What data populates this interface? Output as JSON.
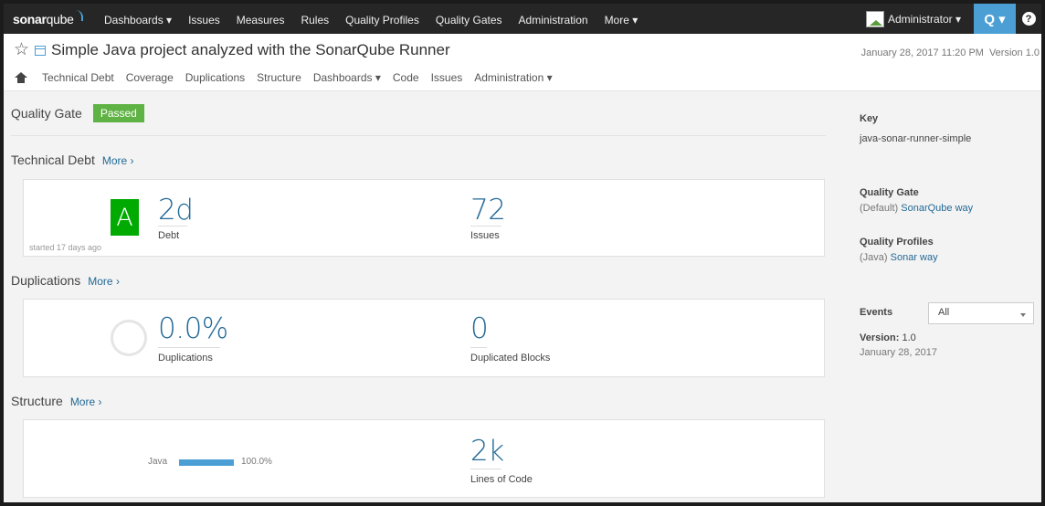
{
  "app": {
    "logo_bold": "sonar",
    "logo_rest": "qube"
  },
  "nav": {
    "items": [
      {
        "label": "Dashboards ▾"
      },
      {
        "label": "Issues"
      },
      {
        "label": "Measures"
      },
      {
        "label": "Rules"
      },
      {
        "label": "Quality Profiles"
      },
      {
        "label": "Quality Gates"
      },
      {
        "label": "Administration"
      },
      {
        "label": "More ▾"
      }
    ],
    "user_label": "Administrator ▾",
    "search_label": "Q ▾",
    "help_label": "?"
  },
  "project": {
    "name": "Simple Java project analyzed with the SonarQube Runner",
    "date": "January 28, 2017 11:20 PM",
    "version": "Version 1.0",
    "subnav": [
      {
        "label": "Technical Debt"
      },
      {
        "label": "Coverage"
      },
      {
        "label": "Duplications"
      },
      {
        "label": "Structure"
      },
      {
        "label": "Dashboards ▾"
      },
      {
        "label": "Code"
      },
      {
        "label": "Issues"
      },
      {
        "label": "Administration ▾"
      }
    ]
  },
  "quality_gate": {
    "label": "Quality Gate",
    "status": "Passed",
    "status_color": "#5fb244"
  },
  "technical_debt": {
    "title": "Technical Debt",
    "more": "More ›",
    "rating": "A",
    "rating_color": "#00aa00",
    "debt_value": "2d",
    "debt_label": "Debt",
    "issues_value": "72",
    "issues_label": "Issues",
    "started": "started 17 days ago"
  },
  "duplications": {
    "title": "Duplications",
    "more": "More ›",
    "dup_value": "0.0%",
    "dup_label": "Duplications",
    "blocks_value": "0",
    "blocks_label": "Duplicated Blocks"
  },
  "structure": {
    "title": "Structure",
    "more": "More ›",
    "language": "Java",
    "language_pct": "100.0%",
    "language_fraction": 1.0,
    "loc_value": "2k",
    "loc_label": "Lines of Code"
  },
  "sidebar": {
    "key_label": "Key",
    "key_value": "java-sonar-runner-simple",
    "qg_label": "Quality Gate",
    "qg_prefix": "(Default)",
    "qg_link": "SonarQube way",
    "qp_label": "Quality Profiles",
    "qp_prefix": "(Java)",
    "qp_link": "Sonar way",
    "events_label": "Events",
    "events_filter": "All",
    "event_version_label": "Version:",
    "event_version_value": "1.0",
    "event_date": "January 28, 2017"
  }
}
